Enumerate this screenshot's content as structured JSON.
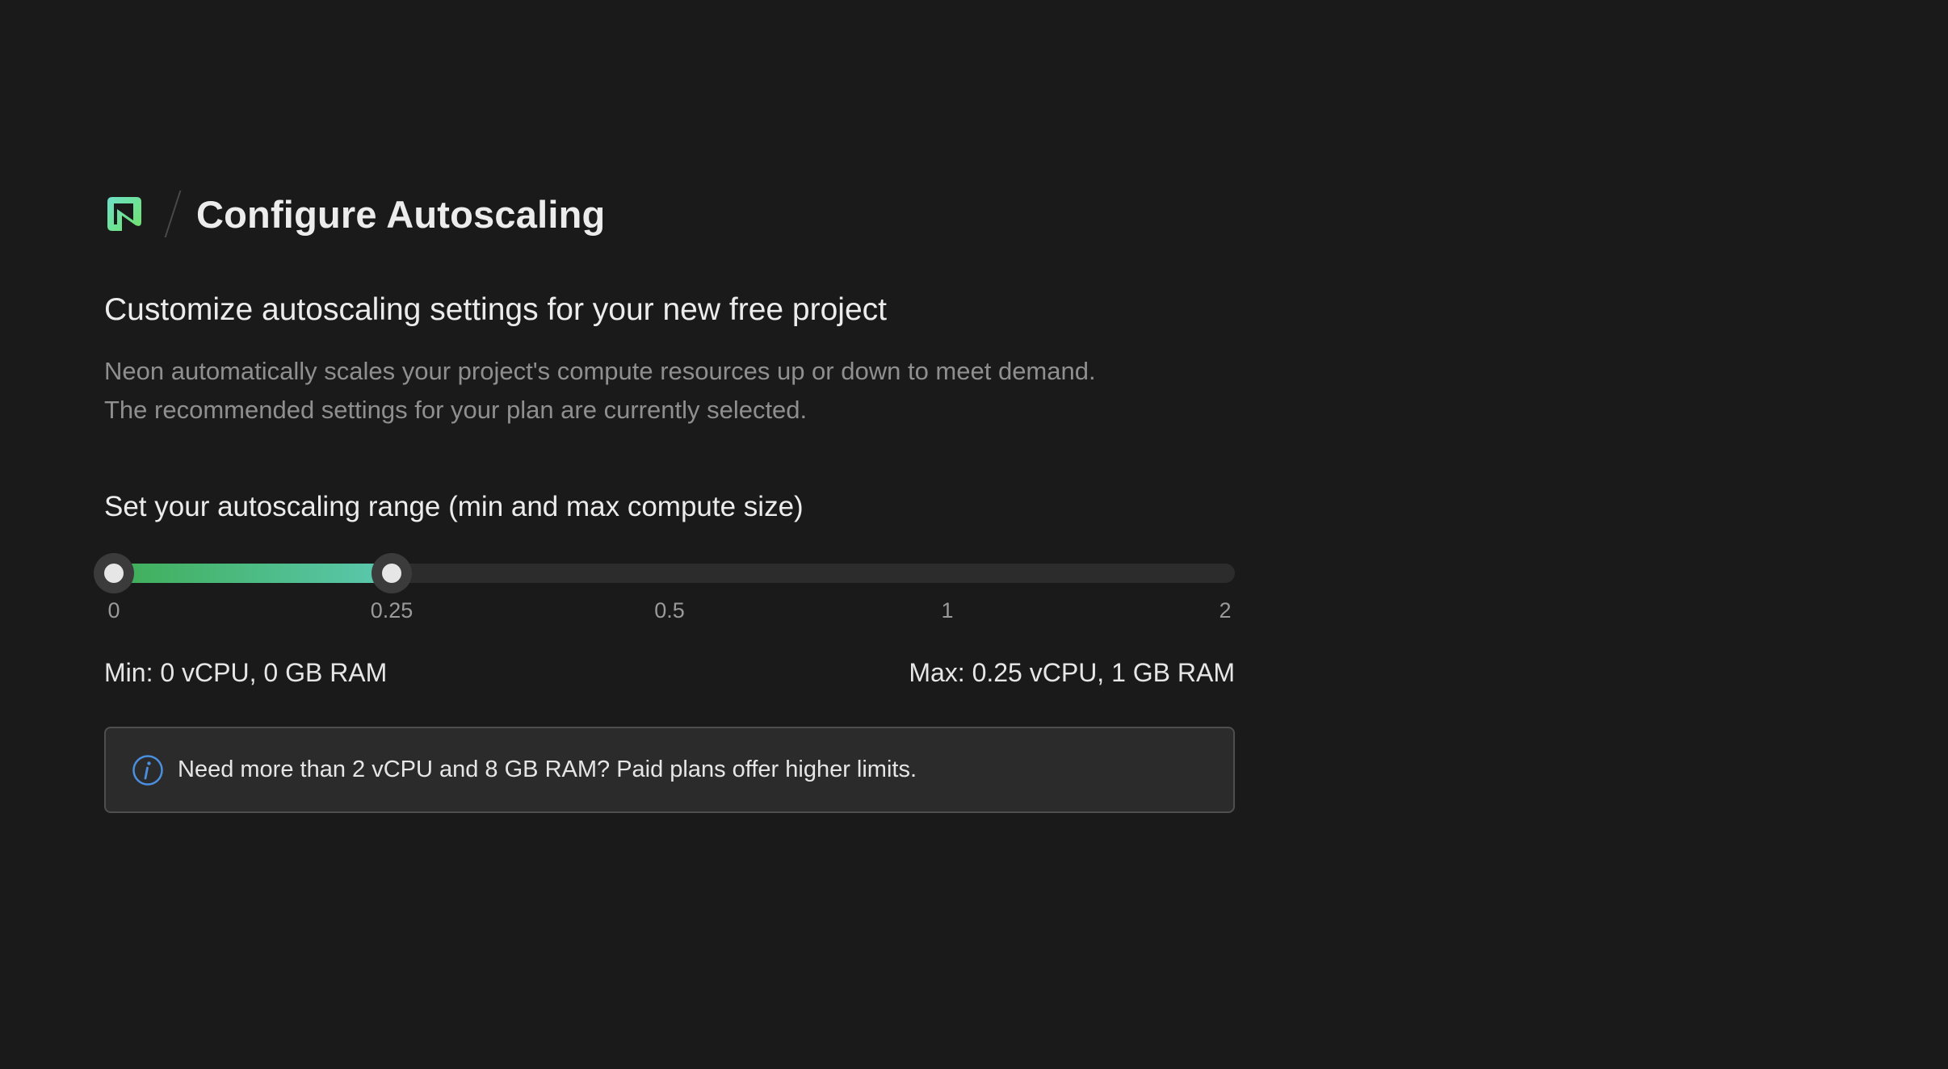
{
  "header": {
    "logo_icon": "neon-logo-icon",
    "title": "Configure Autoscaling"
  },
  "intro": {
    "subtitle": "Customize autoscaling settings for your new free project",
    "description_line1": "Neon automatically scales your project's compute resources up or down to meet demand.",
    "description_line2": "The recommended settings for your plan are currently selected."
  },
  "range": {
    "label": "Set your autoscaling range (min and max compute size)",
    "ticks": [
      "0",
      "0.25",
      "0.5",
      "1",
      "2"
    ],
    "selected_min_tick": 0,
    "selected_max_tick": 1,
    "fill_colors": [
      "#3fae57",
      "#5bc8b0"
    ],
    "min_text": "Min: 0 vCPU, 0 GB RAM",
    "max_text": "Max: 0.25 vCPU, 1 GB RAM"
  },
  "notice": {
    "icon": "info-icon",
    "icon_color": "#4a8fe0",
    "text": "Need more than 2 vCPU and 8 GB RAM? Paid plans offer higher limits."
  }
}
